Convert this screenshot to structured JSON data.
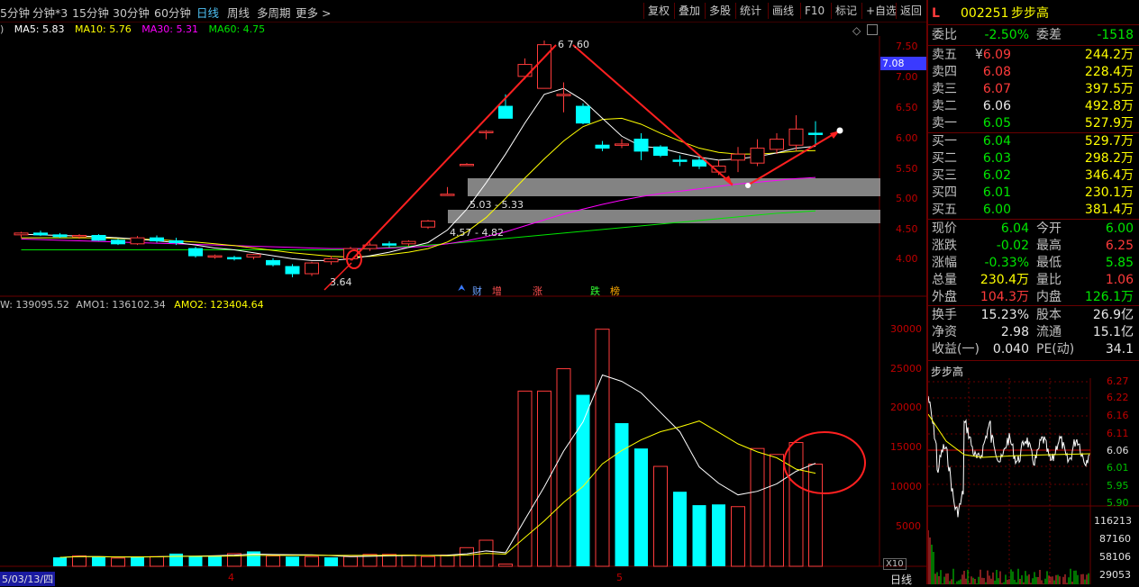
{
  "toolbar": {
    "timeframes": [
      "5分钟",
      "分钟*3",
      "15分钟",
      "30分钟",
      "60分钟",
      "日线",
      "周线",
      "多周期",
      "更多 >"
    ],
    "active_timeframe": "日线",
    "buttons": [
      "复权",
      "叠加",
      "多股",
      "统计",
      "画线",
      "F10",
      "标记",
      "+自选",
      "返回"
    ]
  },
  "ma_legend": {
    "prefix": ")",
    "ma5": "MA5: 5.83",
    "ma10": "MA10: 5.76",
    "ma30": "MA30: 5.31",
    "ma60": "MA60: 4.75"
  },
  "price_axis": [
    "7.50",
    "7.00",
    "6.50",
    "6.00",
    "5.50",
    "5.00",
    "4.50",
    "4.00"
  ],
  "current_price_tag": "7.08",
  "annotations": {
    "high": "6 7.60",
    "low": "3.64",
    "band1": "5.03 - 5.33",
    "band2": "4.57 - 4.82",
    "event_icons": [
      "财",
      "增",
      "涨",
      "跌",
      "榜"
    ]
  },
  "volume_legend": {
    "vol": "W: 139095.52",
    "amo1": "AMO1: 136102.34",
    "amo2": "AMO2: 123404.64"
  },
  "volume_axis": [
    "30000",
    "25000",
    "20000",
    "15000",
    "10000",
    "5000"
  ],
  "volume_unit": "X10",
  "date_axis": {
    "start": "5/03/13/四",
    "m4": "4",
    "m5": "5"
  },
  "bottom_tab": "日线",
  "quote": {
    "header_l": "L",
    "code": "002251",
    "name": "步步高",
    "weibi_label": "委比",
    "weibi": "-2.50%",
    "weicha_label": "委差",
    "weicha": "-1518",
    "asks": [
      {
        "label": "卖五",
        "price": "6.09",
        "vol": "244.2万",
        "cls": "red"
      },
      {
        "label": "卖四",
        "price": "6.08",
        "vol": "228.4万",
        "cls": "red"
      },
      {
        "label": "卖三",
        "price": "6.07",
        "vol": "397.5万",
        "cls": "red"
      },
      {
        "label": "卖二",
        "price": "6.06",
        "vol": "492.8万",
        "cls": "white"
      },
      {
        "label": "卖一",
        "price": "6.05",
        "vol": "527.9万",
        "cls": "green"
      }
    ],
    "bids": [
      {
        "label": "买一",
        "price": "6.04",
        "vol": "529.7万"
      },
      {
        "label": "买二",
        "price": "6.03",
        "vol": "298.2万"
      },
      {
        "label": "买三",
        "price": "6.02",
        "vol": "346.4万"
      },
      {
        "label": "买四",
        "price": "6.01",
        "vol": "230.1万"
      },
      {
        "label": "买五",
        "price": "6.00",
        "vol": "381.4万"
      }
    ],
    "stats": [
      {
        "l1": "现价",
        "v1": "6.04",
        "c1": "green",
        "l2": "今开",
        "v2": "6.00",
        "c2": "green"
      },
      {
        "l1": "涨跌",
        "v1": "-0.02",
        "c1": "green",
        "l2": "最高",
        "v2": "6.25",
        "c2": "red"
      },
      {
        "l1": "涨幅",
        "v1": "-0.33%",
        "c1": "green",
        "l2": "最低",
        "v2": "5.85",
        "c2": "green"
      },
      {
        "l1": "总量",
        "v1": "230.4万",
        "c1": "yellow",
        "l2": "量比",
        "v2": "1.06",
        "c2": "red"
      },
      {
        "l1": "外盘",
        "v1": "104.3万",
        "c1": "red",
        "l2": "内盘",
        "v2": "126.1万",
        "c2": "green"
      }
    ],
    "fund": [
      {
        "l1": "换手",
        "v1": "15.23%",
        "l2": "股本",
        "v2": "26.9亿"
      },
      {
        "l1": "净资",
        "v1": "2.98",
        "l2": "流通",
        "v2": "15.1亿"
      },
      {
        "l1": "收益(一)",
        "v1": "0.040",
        "l2": "PE(动)",
        "v2": "34.1"
      }
    ]
  },
  "mini_chart": {
    "title": "步步高",
    "price_ticks": [
      "6.27",
      "6.22",
      "6.16",
      "6.11",
      "6.06",
      "6.01",
      "5.95",
      "5.90"
    ],
    "vol_ticks": [
      "116213",
      "87160",
      "58106",
      "29053"
    ]
  },
  "chart_data": {
    "type": "candlestick",
    "candles": [
      [
        4.35,
        4.4,
        4.3,
        4.38
      ],
      [
        4.38,
        4.42,
        4.33,
        4.35
      ],
      [
        4.35,
        4.38,
        4.3,
        4.32
      ],
      [
        4.32,
        4.36,
        4.28,
        4.34
      ],
      [
        4.34,
        4.36,
        4.25,
        4.26
      ],
      [
        4.26,
        4.28,
        4.18,
        4.2
      ],
      [
        4.2,
        4.33,
        4.18,
        4.3
      ],
      [
        4.3,
        4.34,
        4.22,
        4.25
      ],
      [
        4.25,
        4.3,
        4.18,
        4.22
      ],
      [
        4.12,
        4.15,
        3.97,
        4.0
      ],
      [
        4.0,
        4.02,
        3.95,
        4.0
      ],
      [
        3.97,
        4.0,
        3.92,
        3.95
      ],
      [
        3.98,
        4.03,
        3.94,
        4.02
      ],
      [
        3.92,
        3.96,
        3.82,
        3.85
      ],
      [
        3.82,
        3.86,
        3.64,
        3.7
      ],
      [
        3.7,
        3.9,
        3.66,
        3.88
      ],
      [
        3.9,
        4.0,
        3.85,
        3.95
      ],
      [
        3.95,
        4.15,
        3.92,
        4.12
      ],
      [
        4.12,
        4.22,
        4.08,
        4.18
      ],
      [
        4.2,
        4.24,
        4.14,
        4.18
      ],
      [
        4.2,
        4.26,
        4.16,
        4.24
      ],
      [
        4.48,
        4.6,
        4.45,
        4.58
      ],
      [
        5.03,
        5.15,
        5.0,
        5.03
      ],
      [
        5.53,
        5.55,
        5.5,
        5.53
      ],
      [
        6.08,
        6.1,
        5.95,
        6.08
      ],
      [
        6.5,
        6.7,
        6.3,
        6.3
      ],
      [
        7.0,
        7.3,
        6.95,
        7.2
      ],
      [
        6.8,
        7.6,
        6.8,
        7.53
      ],
      [
        6.7,
        6.9,
        6.4,
        6.7
      ],
      [
        6.5,
        6.55,
        6.2,
        6.22
      ],
      [
        5.85,
        5.92,
        5.75,
        5.8
      ],
      [
        5.85,
        5.95,
        5.8,
        5.87
      ],
      [
        5.95,
        6.05,
        5.6,
        5.75
      ],
      [
        5.82,
        5.85,
        5.65,
        5.68
      ],
      [
        5.6,
        5.68,
        5.5,
        5.58
      ],
      [
        5.6,
        5.65,
        5.45,
        5.5
      ],
      [
        5.4,
        5.6,
        5.35,
        5.5
      ],
      [
        5.6,
        5.82,
        5.4,
        5.7
      ],
      [
        5.55,
        5.95,
        5.5,
        5.8
      ],
      [
        5.78,
        6.05,
        5.7,
        5.95
      ],
      [
        5.85,
        6.35,
        5.75,
        6.12
      ],
      [
        6.05,
        6.25,
        5.85,
        6.04
      ]
    ],
    "volume": [
      1200,
      1400,
      1300,
      1100,
      1300,
      1300,
      1700,
      1400,
      1400,
      1700,
      2000,
      1400,
      1300,
      1300,
      1200,
      1300,
      1600,
      1600,
      1500,
      1300,
      1500,
      2500,
      3500,
      300,
      23500,
      23500,
      26500,
      23000,
      31800,
      19200,
      15800,
      13400,
      10000,
      8200,
      8300,
      8000,
      15800,
      15000,
      16600,
      13700
    ],
    "vol_colors": [
      "c",
      "r",
      "c",
      "r",
      "c",
      "r",
      "c",
      "c",
      "c",
      "r",
      "c",
      "r",
      "c",
      "r",
      "c",
      "r",
      "r",
      "r",
      "r",
      "r",
      "r",
      "r",
      "r",
      "r",
      "r",
      "r",
      "r",
      "c",
      "r",
      "c",
      "c",
      "r",
      "c",
      "c",
      "c",
      "r",
      "r",
      "r",
      "r",
      "r"
    ],
    "ma5": [
      4.36,
      4.35,
      4.34,
      4.33,
      4.32,
      4.3,
      4.28,
      4.25,
      4.22,
      4.18,
      4.13,
      4.1,
      4.05,
      4.0,
      3.95,
      3.92,
      3.92,
      3.95,
      4.0,
      4.06,
      4.14,
      4.22,
      4.43,
      4.78,
      5.22,
      5.7,
      6.22,
      6.7,
      6.8,
      6.6,
      6.3,
      6.0,
      5.83,
      5.8,
      5.72,
      5.65,
      5.6,
      5.62,
      5.66,
      5.72,
      5.8,
      5.83
    ],
    "ma10": [
      4.3,
      4.3,
      4.3,
      4.3,
      4.3,
      4.29,
      4.28,
      4.27,
      4.25,
      4.23,
      4.2,
      4.17,
      4.13,
      4.09,
      4.05,
      4.02,
      3.99,
      3.98,
      3.99,
      4.02,
      4.06,
      4.12,
      4.23,
      4.4,
      4.64,
      4.96,
      5.3,
      5.62,
      5.92,
      6.16,
      6.28,
      6.3,
      6.2,
      6.05,
      5.92,
      5.8,
      5.73,
      5.7,
      5.7,
      5.72,
      5.75,
      5.76
    ],
    "ma30": [
      4.28,
      4.27,
      4.26,
      4.25,
      4.24,
      4.23,
      4.22,
      4.21,
      4.2,
      4.19,
      4.18,
      4.17,
      4.16,
      4.15,
      4.14,
      4.13,
      4.12,
      4.12,
      4.12,
      4.13,
      4.14,
      4.16,
      4.2,
      4.25,
      4.32,
      4.4,
      4.5,
      4.6,
      4.7,
      4.78,
      4.86,
      4.93,
      4.99,
      5.04,
      5.08,
      5.12,
      5.16,
      5.2,
      5.23,
      5.26,
      5.29,
      5.31
    ],
    "ma60": [
      4.1,
      4.1,
      4.1,
      4.1,
      4.1,
      4.1,
      4.1,
      4.1,
      4.1,
      4.1,
      4.1,
      4.1,
      4.1,
      4.1,
      4.1,
      4.1,
      4.1,
      4.1,
      4.12,
      4.14,
      4.16,
      4.18,
      4.2,
      4.23,
      4.26,
      4.29,
      4.32,
      4.35,
      4.38,
      4.41,
      4.44,
      4.47,
      4.5,
      4.53,
      4.56,
      4.59,
      4.62,
      4.65,
      4.68,
      4.71,
      4.73,
      4.75
    ],
    "ylim": [
      3.5,
      7.8
    ]
  }
}
